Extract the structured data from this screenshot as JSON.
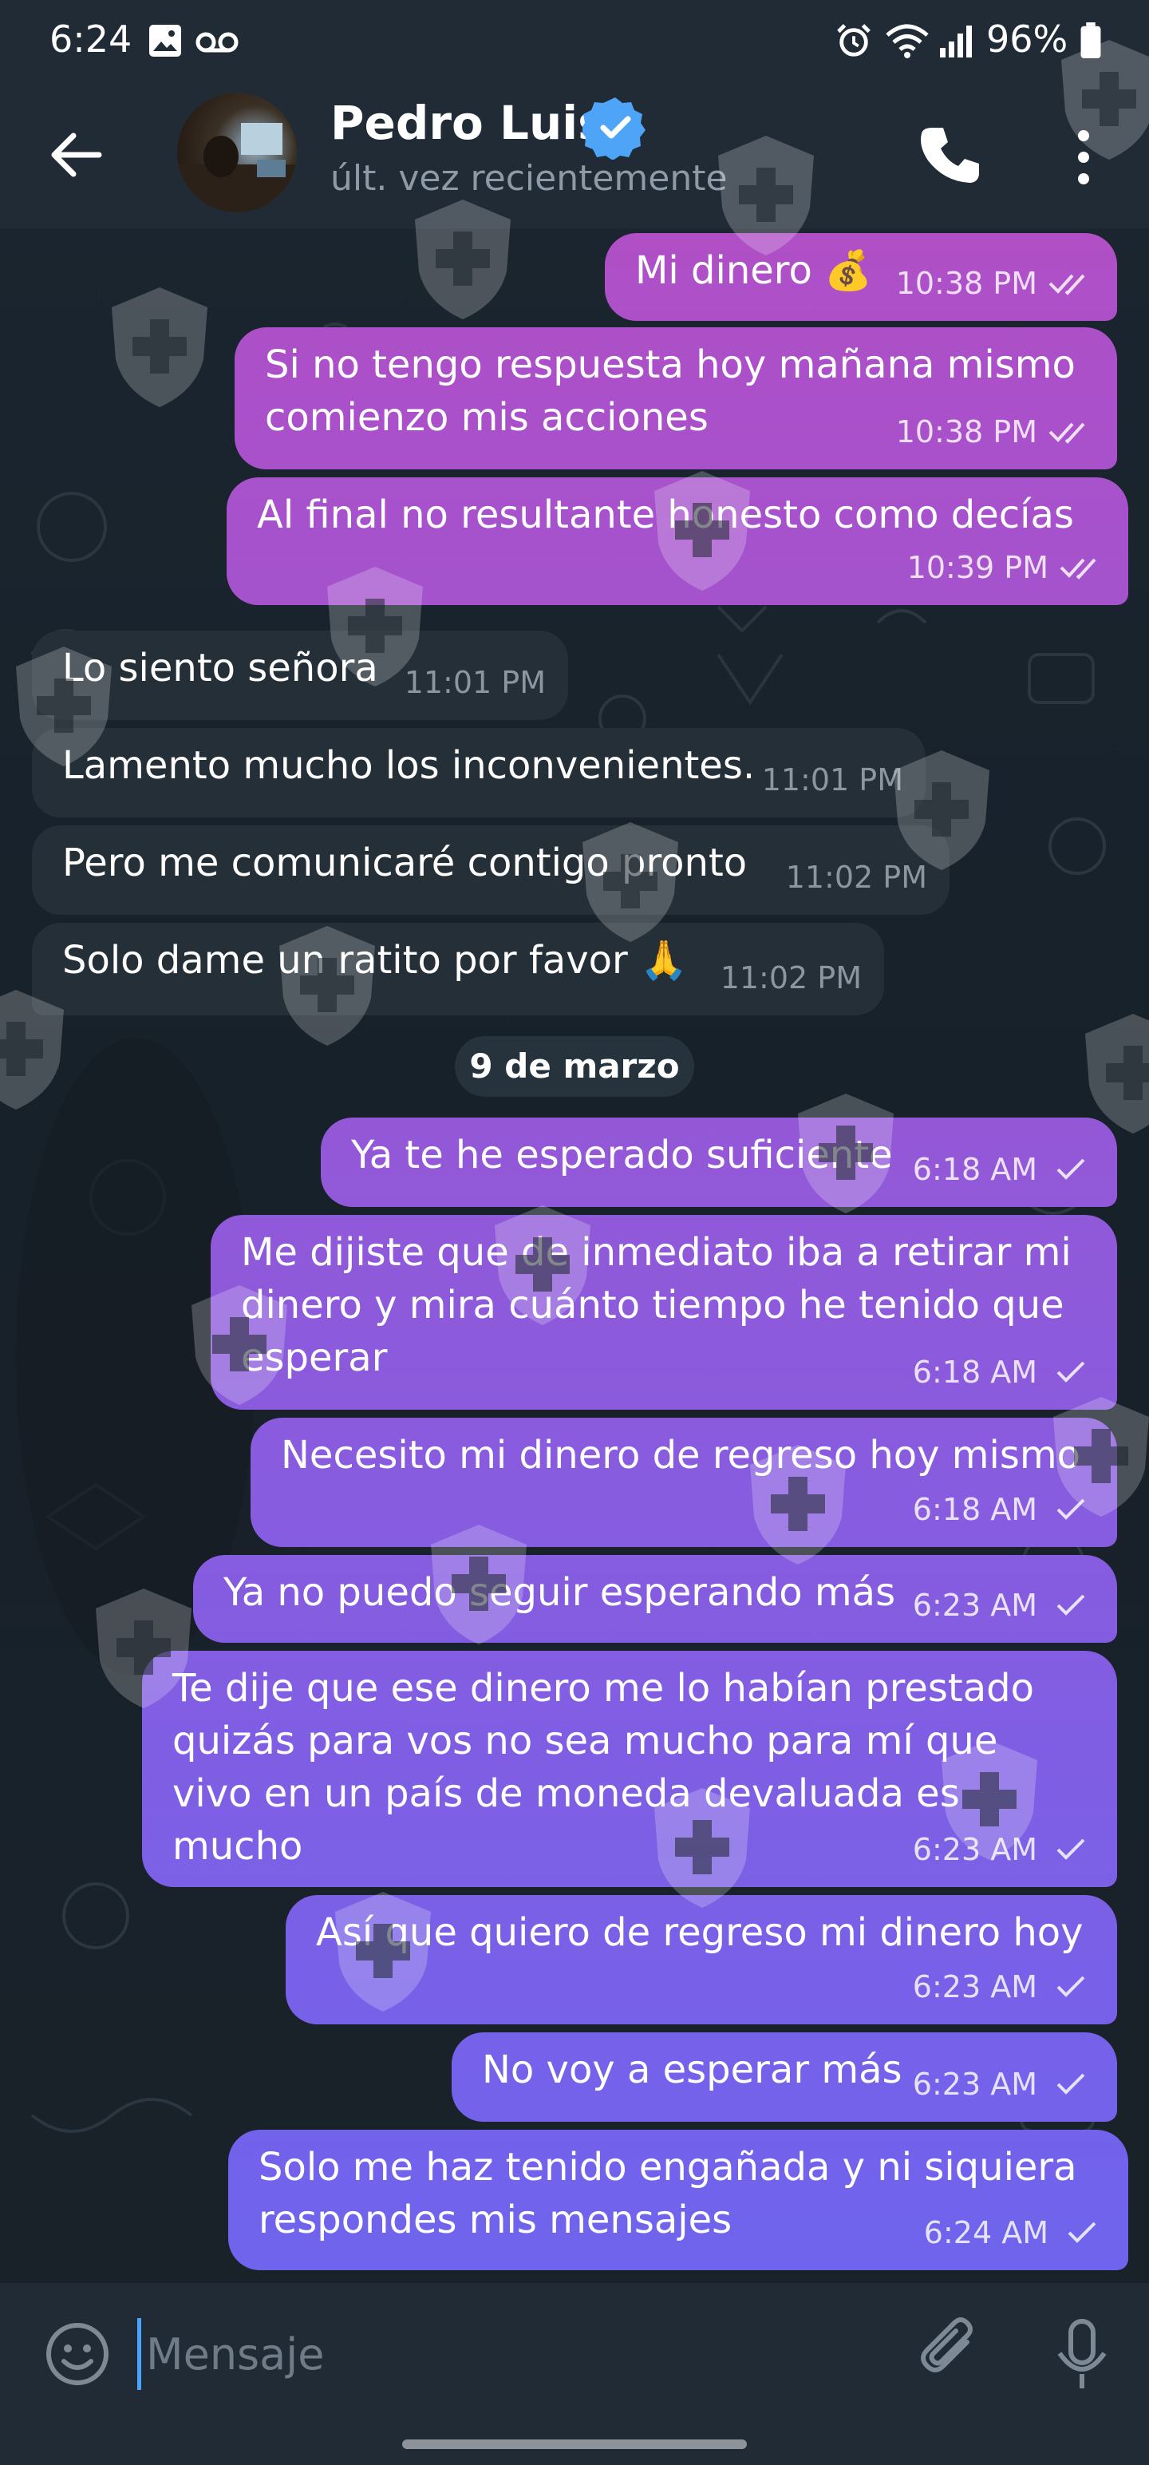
{
  "status_bar": {
    "time": "6:24",
    "battery": "96%",
    "icons": [
      "image-icon",
      "voicemail-icon",
      "alarm-icon",
      "wifi-icon",
      "signal-icon",
      "battery-icon"
    ]
  },
  "header": {
    "contact_name": "Pedro Luis",
    "verified": true,
    "last_seen": "últ. vez recientemente"
  },
  "messages": [
    {
      "direction": "out",
      "text": "Mi dinero 💰",
      "time": "10:38 PM",
      "status": "read"
    },
    {
      "direction": "out",
      "text": "Si no tengo respuesta hoy mañana mismo comienzo mis acciones",
      "time": "10:38 PM",
      "status": "read"
    },
    {
      "direction": "out",
      "text": "Al final no resultante honesto como decías",
      "time": "10:39 PM",
      "status": "read"
    },
    {
      "direction": "in",
      "text": "Lo siento señora",
      "time": "11:01 PM"
    },
    {
      "direction": "in",
      "text": "Lamento mucho los inconvenientes.",
      "time": "11:01 PM"
    },
    {
      "direction": "in",
      "text": "Pero me comunicaré contigo pronto",
      "time": "11:02 PM"
    },
    {
      "direction": "in",
      "text": "Solo dame un ratito por favor 🙏",
      "time": "11:02 PM"
    },
    {
      "direction": "out",
      "text": "Ya te he esperado suficiente",
      "time": "6:18 AM",
      "status": "sent"
    },
    {
      "direction": "out",
      "text": "Me dijiste que de inmediato iba a retirar mi dinero y mira cuánto tiempo he tenido que esperar",
      "time": "6:18 AM",
      "status": "sent"
    },
    {
      "direction": "out",
      "text": "Necesito mi dinero de regreso hoy mismo",
      "time": "6:18 AM",
      "status": "sent"
    },
    {
      "direction": "out",
      "text": "Ya no puedo seguir esperando más",
      "time": "6:23 AM",
      "status": "sent"
    },
    {
      "direction": "out",
      "text": "Te dije que ese dinero me lo habían prestado quizás para vos no sea mucho para mí que vivo en un país de moneda devaluada es mucho",
      "time": "6:23 AM",
      "status": "sent"
    },
    {
      "direction": "out",
      "text": "Así que quiero de regreso mi dinero hoy",
      "time": "6:23 AM",
      "status": "sent"
    },
    {
      "direction": "out",
      "text": "No voy a esperar más",
      "time": "6:23 AM",
      "status": "sent"
    },
    {
      "direction": "out",
      "text": "Solo me haz tenido engañada y ni siquiera respondes mis mensajes",
      "time": "6:24 AM",
      "status": "sent"
    }
  ],
  "date_separator": "9 de marzo",
  "composer": {
    "placeholder": "Mensaje"
  },
  "colors": {
    "outgoing_top": "#b04fc6",
    "outgoing_bottom": "#6e64ee",
    "incoming": "#252f38",
    "header": "#202b36",
    "accent": "#4aa3ff"
  }
}
